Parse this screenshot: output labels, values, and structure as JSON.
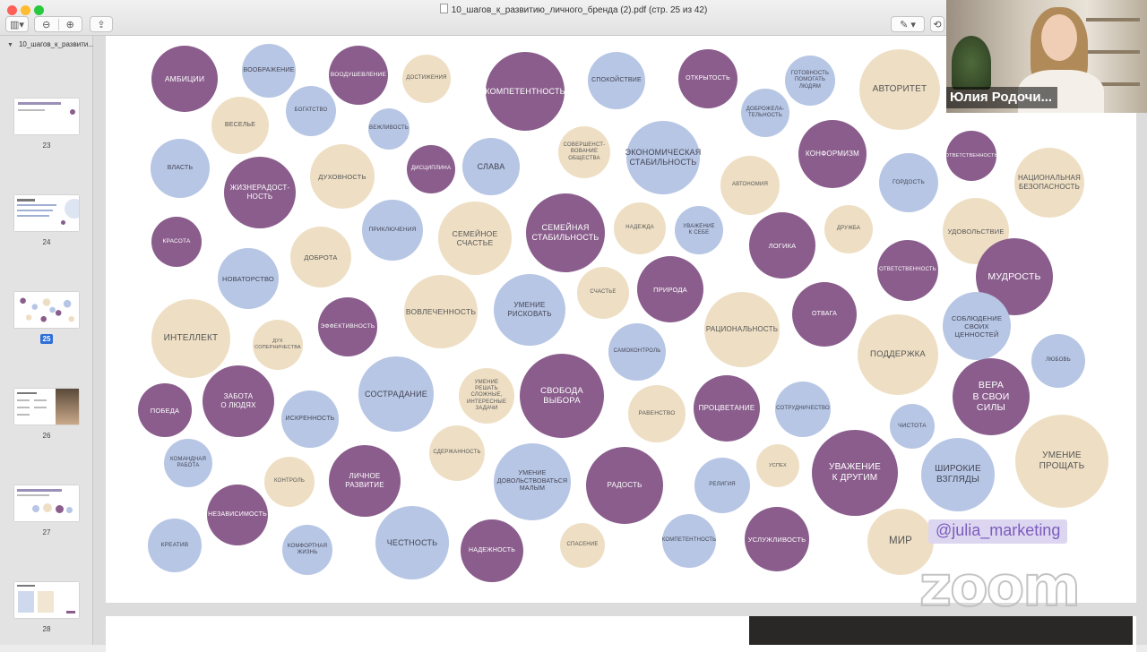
{
  "window": {
    "title": "10_шагов_к_развитию_личного_бренда (2).pdf (стр. 25 из 42)"
  },
  "sidebar": {
    "document_name": "10_шагов_к_развити...",
    "pages": [
      {
        "number": "23",
        "selected": false
      },
      {
        "number": "24",
        "selected": false
      },
      {
        "number": "25",
        "selected": true
      },
      {
        "number": "26",
        "selected": false
      },
      {
        "number": "27",
        "selected": false
      },
      {
        "number": "28",
        "selected": false
      }
    ]
  },
  "toolbar": {
    "sidebar_icon": "sidebar-toggle-icon",
    "zoom_out_icon": "zoom-out-icon",
    "zoom_in_icon": "zoom-in-icon",
    "share_icon": "share-icon",
    "markup_icon": "pen-icon"
  },
  "colors": {
    "purple": "#8a5d8c",
    "blue": "#b6c6e4",
    "beige": "#eedfc4",
    "selection": "#2f6fd8"
  },
  "values": [
    {
      "text": "Амбиции",
      "color": "purple"
    },
    {
      "text": "Воображение",
      "color": "blue"
    },
    {
      "text": "Воодушевление",
      "color": "purple"
    },
    {
      "text": "Достижения",
      "color": "beige"
    },
    {
      "text": "Компетентность",
      "color": "purple"
    },
    {
      "text": "Спокойствие",
      "color": "blue"
    },
    {
      "text": "Открытость",
      "color": "purple"
    },
    {
      "text": "Готовность\nпомогать\nлюдям",
      "color": "blue"
    },
    {
      "text": "Авторитет",
      "color": "beige"
    },
    {
      "text": "Веселье",
      "color": "beige"
    },
    {
      "text": "Богатство",
      "color": "blue"
    },
    {
      "text": "Вежливость",
      "color": "blue"
    },
    {
      "text": "Совершенст-\nвование\nобщества",
      "color": "beige"
    },
    {
      "text": "Доброжела-\nтельность",
      "color": "blue"
    },
    {
      "text": "Власть",
      "color": "blue"
    },
    {
      "text": "Жизнерадост-\nность",
      "color": "purple"
    },
    {
      "text": "Духовность",
      "color": "beige"
    },
    {
      "text": "Дисциплина",
      "color": "purple"
    },
    {
      "text": "Слава",
      "color": "blue"
    },
    {
      "text": "Экономическая\nстабильность",
      "color": "blue"
    },
    {
      "text": "Конформизм",
      "color": "purple"
    },
    {
      "text": "Ответственность",
      "color": "purple"
    },
    {
      "text": "Национальная\nбезопасность",
      "color": "beige"
    },
    {
      "text": "Автономия",
      "color": "beige"
    },
    {
      "text": "Гордость",
      "color": "blue"
    },
    {
      "text": "Красота",
      "color": "purple"
    },
    {
      "text": "Приключения",
      "color": "blue"
    },
    {
      "text": "Семейное\nсчастье",
      "color": "beige"
    },
    {
      "text": "Семейная\nстабильность",
      "color": "purple"
    },
    {
      "text": "Надежда",
      "color": "beige"
    },
    {
      "text": "Уважение\nк себе",
      "color": "blue"
    },
    {
      "text": "Логика",
      "color": "purple"
    },
    {
      "text": "Дружба",
      "color": "beige"
    },
    {
      "text": "Удовольствие",
      "color": "beige"
    },
    {
      "text": "Доброта",
      "color": "beige"
    },
    {
      "text": "Новаторство",
      "color": "blue"
    },
    {
      "text": "Ответственность",
      "color": "purple"
    },
    {
      "text": "Мудрость",
      "color": "purple"
    },
    {
      "text": "Природа",
      "color": "purple"
    },
    {
      "text": "Счастье",
      "color": "beige"
    },
    {
      "text": "Интеллект",
      "color": "beige"
    },
    {
      "text": "Вовлеченность",
      "color": "beige"
    },
    {
      "text": "Умение\nрисковать",
      "color": "blue"
    },
    {
      "text": "Рациональность",
      "color": "beige"
    },
    {
      "text": "Отвага",
      "color": "purple"
    },
    {
      "text": "Соблюдение\nсвоих\nценностей",
      "color": "blue"
    },
    {
      "text": "Дух\nсоперничества",
      "color": "beige"
    },
    {
      "text": "Эффективность",
      "color": "purple"
    },
    {
      "text": "Самоконтроль",
      "color": "blue"
    },
    {
      "text": "Поддержка",
      "color": "beige"
    },
    {
      "text": "Любовь",
      "color": "blue"
    },
    {
      "text": "Сострадание",
      "color": "blue"
    },
    {
      "text": "Умение решать\nсложные,\nинтересные\nзадачи",
      "color": "beige"
    },
    {
      "text": "Свобода\nвыбора",
      "color": "purple"
    },
    {
      "text": "Вера\nв свои\nсилы",
      "color": "purple"
    },
    {
      "text": "Победа",
      "color": "purple"
    },
    {
      "text": "Забота\nо людях",
      "color": "purple"
    },
    {
      "text": "Искренность",
      "color": "blue"
    },
    {
      "text": "Равенство",
      "color": "beige"
    },
    {
      "text": "Процветание",
      "color": "purple"
    },
    {
      "text": "Сотрудничество",
      "color": "blue"
    },
    {
      "text": "Чистота",
      "color": "blue"
    },
    {
      "text": "Умение\nпрощать",
      "color": "beige"
    },
    {
      "text": "Командная\nработа",
      "color": "blue"
    },
    {
      "text": "Сдержанность",
      "color": "beige"
    },
    {
      "text": "Личное\nразвитие",
      "color": "purple"
    },
    {
      "text": "Контроль",
      "color": "beige"
    },
    {
      "text": "Умение\nдовольствоваться\nмалым",
      "color": "blue"
    },
    {
      "text": "Радость",
      "color": "purple"
    },
    {
      "text": "Религия",
      "color": "blue"
    },
    {
      "text": "Успех",
      "color": "beige"
    },
    {
      "text": "Уважение\nк другим",
      "color": "purple"
    },
    {
      "text": "Широкие\nвзгляды",
      "color": "blue"
    },
    {
      "text": "Независимость",
      "color": "purple"
    },
    {
      "text": "Креатив",
      "color": "blue"
    },
    {
      "text": "Комфортная\nжизнь",
      "color": "blue"
    },
    {
      "text": "Честность",
      "color": "blue"
    },
    {
      "text": "Надежность",
      "color": "purple"
    },
    {
      "text": "Спасение",
      "color": "beige"
    },
    {
      "text": "Компетентность",
      "color": "blue"
    },
    {
      "text": "Услужливость",
      "color": "purple"
    },
    {
      "text": "Мир",
      "color": "beige"
    }
  ],
  "overlay": {
    "handle": "@julia_marketing",
    "zoom_watermark": "zoom",
    "webcam_name": "Юлия Родочи..."
  }
}
